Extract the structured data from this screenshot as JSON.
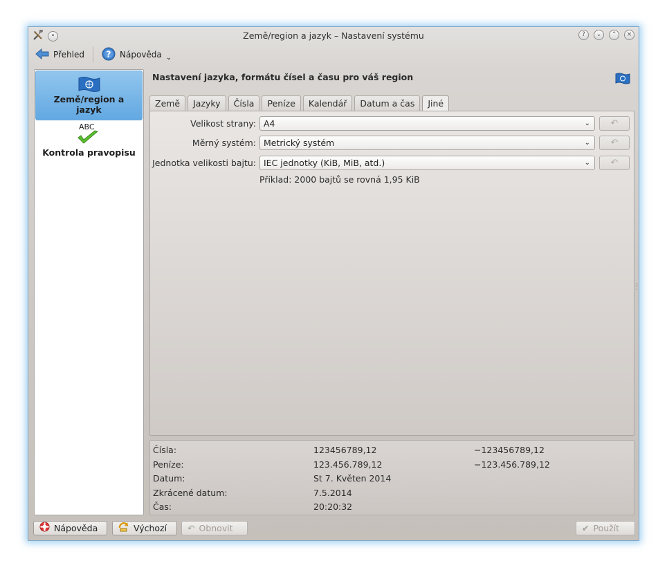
{
  "window": {
    "title": "Země/region a jazyk – Nastavení systému"
  },
  "toolbar": {
    "overview_label": "Přehled",
    "help_label": "Nápověda"
  },
  "sidebar": {
    "items": [
      {
        "label": "Země/region a jazyk",
        "selected": true
      },
      {
        "label": "Kontrola pravopisu",
        "selected": false,
        "icon_text": "ABC"
      }
    ]
  },
  "main": {
    "heading": "Nastavení jazyka, formátu čísel a času pro váš region",
    "tabs": [
      {
        "label": "Země",
        "active": false
      },
      {
        "label": "Jazyky",
        "active": false
      },
      {
        "label": "Čísla",
        "active": false
      },
      {
        "label": "Peníze",
        "active": false
      },
      {
        "label": "Kalendář",
        "active": false
      },
      {
        "label": "Datum a čas",
        "active": false
      },
      {
        "label": "Jiné",
        "active": true
      }
    ],
    "fields": [
      {
        "label": "Velikost strany:",
        "value": "A4"
      },
      {
        "label": "Měrný systém:",
        "value": "Metrický systém"
      },
      {
        "label": "Jednotka velikosti bajtu:",
        "value": "IEC jednotky (KiB, MiB, atd.)"
      }
    ],
    "example": "Příklad: 2000 bajtů se rovná 1,95 KiB"
  },
  "preview": {
    "rows": [
      {
        "label": "Čísla:",
        "positive": "123456789,12",
        "negative": "−123456789,12"
      },
      {
        "label": "Peníze:",
        "positive": "123.456.789,12",
        "negative": "−123.456.789,12"
      },
      {
        "label": "Datum:",
        "positive": "St 7. Květen 2014",
        "negative": ""
      },
      {
        "label": "Zkrácené datum:",
        "positive": "7.5.2014",
        "negative": ""
      },
      {
        "label": "Čas:",
        "positive": "20:20:32",
        "negative": ""
      }
    ]
  },
  "buttons": {
    "help": "Nápověda",
    "defaults": "Výchozí",
    "reset": "Obnovit",
    "apply": "Použít"
  },
  "colors": {
    "selection": "#62a8e2",
    "window_glow": "#54aae6",
    "apply_check": "#4caf28"
  }
}
